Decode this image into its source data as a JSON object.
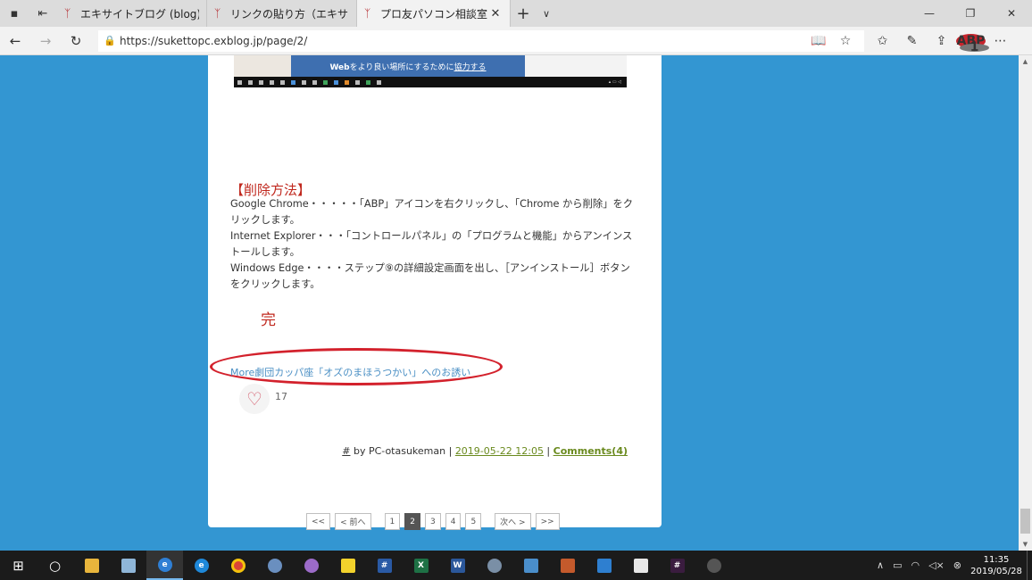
{
  "tabs": [
    {
      "title": "エキサイトブログ (blog)|下書き",
      "active": false
    },
    {
      "title": "リンクの貼り方（エキサイトブログ",
      "active": false
    },
    {
      "title": "プロ友パソコン相談室",
      "active": true
    }
  ],
  "address": {
    "url": "https://sukettopc.exblog.jp/page/2/"
  },
  "abp": {
    "label": "ABP",
    "badge": "1"
  },
  "embedded_screenshot": {
    "banner_bold": "Web",
    "banner_text": "をより良い場所にするために",
    "banner_link": "協力する"
  },
  "post": {
    "heading": "【削除方法】",
    "lines": [
      "Google Chrome・・・・・「ABP」アイコンを右クリックし、「Chrome から削除」をクリックします。",
      "Internet Explorer・・・「コントロールパネル」の「プログラムと機能」からアンインストールします。",
      "Windows Edge・・・・ステップ⑨の詳細設定画面を出し、［アンインストール］ボタンをクリックします。"
    ],
    "end_mark": "完",
    "more_link": "More劇団カッパ座「オズのまほうつかい」へのお誘い",
    "like_count": "17",
    "meta": {
      "hash": "#",
      "by": " by PC-otasukeman | ",
      "date": "2019-05-22 12:05",
      "sep": " | ",
      "comments": "Comments(4)"
    }
  },
  "pager": {
    "first": "<<",
    "prev": "< 前へ",
    "pages": [
      "1",
      "2",
      "3",
      "4",
      "5"
    ],
    "current": "2",
    "next": "次へ >",
    "last": ">>"
  },
  "taskbar": {
    "clock_time": "11:35",
    "clock_date": "2019/05/28"
  }
}
